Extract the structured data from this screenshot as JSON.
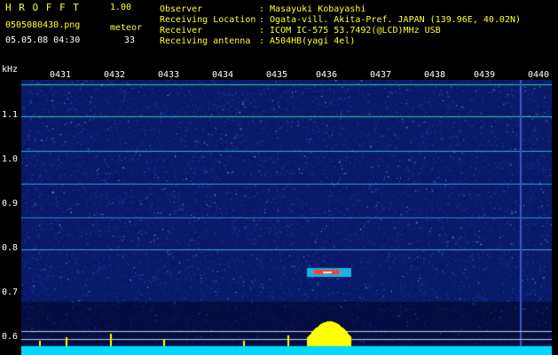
{
  "header": {
    "app_title": "H R O F F T",
    "version": "1.00",
    "filename": "0505080430.png",
    "datetime": "05.05.08 04:30",
    "mode_label": "meteor",
    "count": "33",
    "info_labels": [
      "Observer",
      "Receiving Location",
      "Receiver",
      "Receiving antenna"
    ],
    "info_values": [
      ": Masayuki Kobayashi",
      ": Ogata-vill. Akita-Pref. JAPAN (139.96E, 40.02N)",
      ": ICOM IC-575 53.7492(@LCD)MHz USB",
      ": A504HB(yagi 4el)"
    ]
  },
  "axis": {
    "unit": "kHz",
    "x_ticks": [
      "0431",
      "0432",
      "0433",
      "0434",
      "0435",
      "0436",
      "0437",
      "0438",
      "0439",
      "0440"
    ],
    "y_ticks": [
      "1.1",
      "1.0",
      "0.9",
      "0.8",
      "0.7",
      "0.6"
    ]
  },
  "colors": {
    "background": "#000000",
    "spectrum": "#0a1a6b",
    "label_yellow": "#ffff33",
    "trace_line": "#00e6ff",
    "level_bar": "#ffff00"
  }
}
